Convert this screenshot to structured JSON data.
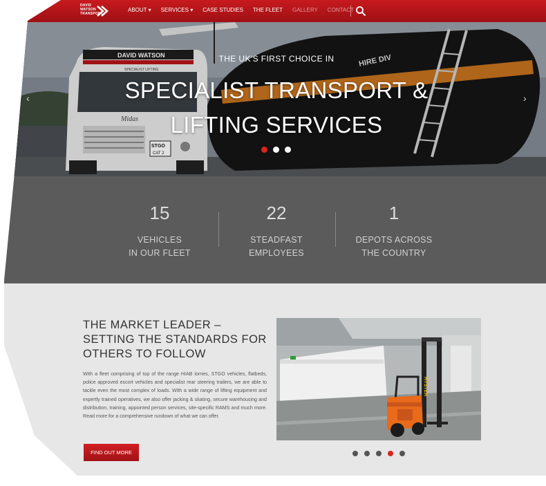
{
  "brand": {
    "logo_text": "DAVID\nWATSON\nTRANSPORT"
  },
  "nav": {
    "items": [
      {
        "label": "ABOUT ▾"
      },
      {
        "label": "SERVICES ▾"
      },
      {
        "label": "CASE STUDIES"
      },
      {
        "label": "THE FLEET"
      },
      {
        "label": "GALLERY"
      },
      {
        "label": "CONTACT"
      }
    ]
  },
  "hero": {
    "pretitle": "THE UK'S FIRST CHOICE IN",
    "title_line1": "SPECIALIST TRANSPORT &",
    "title_line2": "LIFTING SERVICES",
    "truck_cab_text": "DAVID WATSON",
    "truck_sub_text": "SPECIALIST LIFTING",
    "truck_name": "Midas",
    "plate1": "STGO",
    "plate2": "CAT 2",
    "tank_text": "HIRE DIV",
    "slides_total": 3,
    "active_slide": 1
  },
  "stats": [
    {
      "number": "15",
      "line1": "VEHICLES",
      "line2": "IN OUR FLEET"
    },
    {
      "number": "22",
      "line1": "STEADFAST",
      "line2": "EMPLOYEES"
    },
    {
      "number": "1",
      "line1": "DEPOTS ACROSS",
      "line2": "THE COUNTRY"
    }
  ],
  "market": {
    "title_line1": "THE MARKET LEADER –",
    "title_line2": "SETTING THE STANDARDS FOR",
    "title_line3": "OTHERS TO FOLLOW",
    "body": "With a fleet comprising of top of the range HIAB lorries, STGO vehicles, flatbeds, police approved escort vehicles and specialist rear steering trailers, we are able to tackle even the most complex of loads. With a wide range of lifting equipment and expertly trained operatives, we also offer jacking & skating, secure warehousing and distribution, training, appointed person services, site-specific RAMS and much more. Read more for a comprehensive rundown of what we can offer.",
    "button_label": "FIND OUT MORE",
    "forklift_text": "HYSTER",
    "gallery_total": 5,
    "gallery_active": 4
  },
  "colors": {
    "accent": "#c81a1e",
    "stats_bg": "#5b5b5b",
    "section_bg": "#e7e7e7"
  }
}
